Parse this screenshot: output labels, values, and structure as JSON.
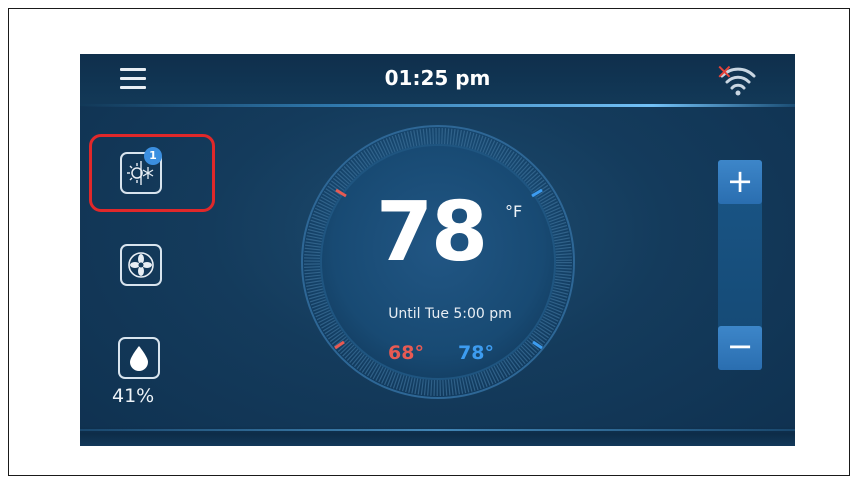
{
  "header": {
    "time": "01:25 pm",
    "wifi_status": "disconnected",
    "menu_icon": "hamburger-menu-icon"
  },
  "sidebar": {
    "mode_button": {
      "icon": "heat-cool-mode-icon",
      "badge": "1"
    },
    "fan_button": {
      "icon": "fan-icon"
    },
    "humidity": {
      "icon": "water-drop-icon",
      "value": "41%"
    }
  },
  "main": {
    "current_temp": "78",
    "unit": "°F",
    "hold_text": "Until Tue 5:00 pm",
    "heat_setpoint": "68°",
    "cool_setpoint": "78°"
  },
  "controls": {
    "increase_label": "+",
    "decrease_label": "−"
  },
  "colors": {
    "heat": "#e85a53",
    "cool": "#3d9cf0",
    "highlight": "#e0282a",
    "screen_bg": "#143b5c"
  }
}
